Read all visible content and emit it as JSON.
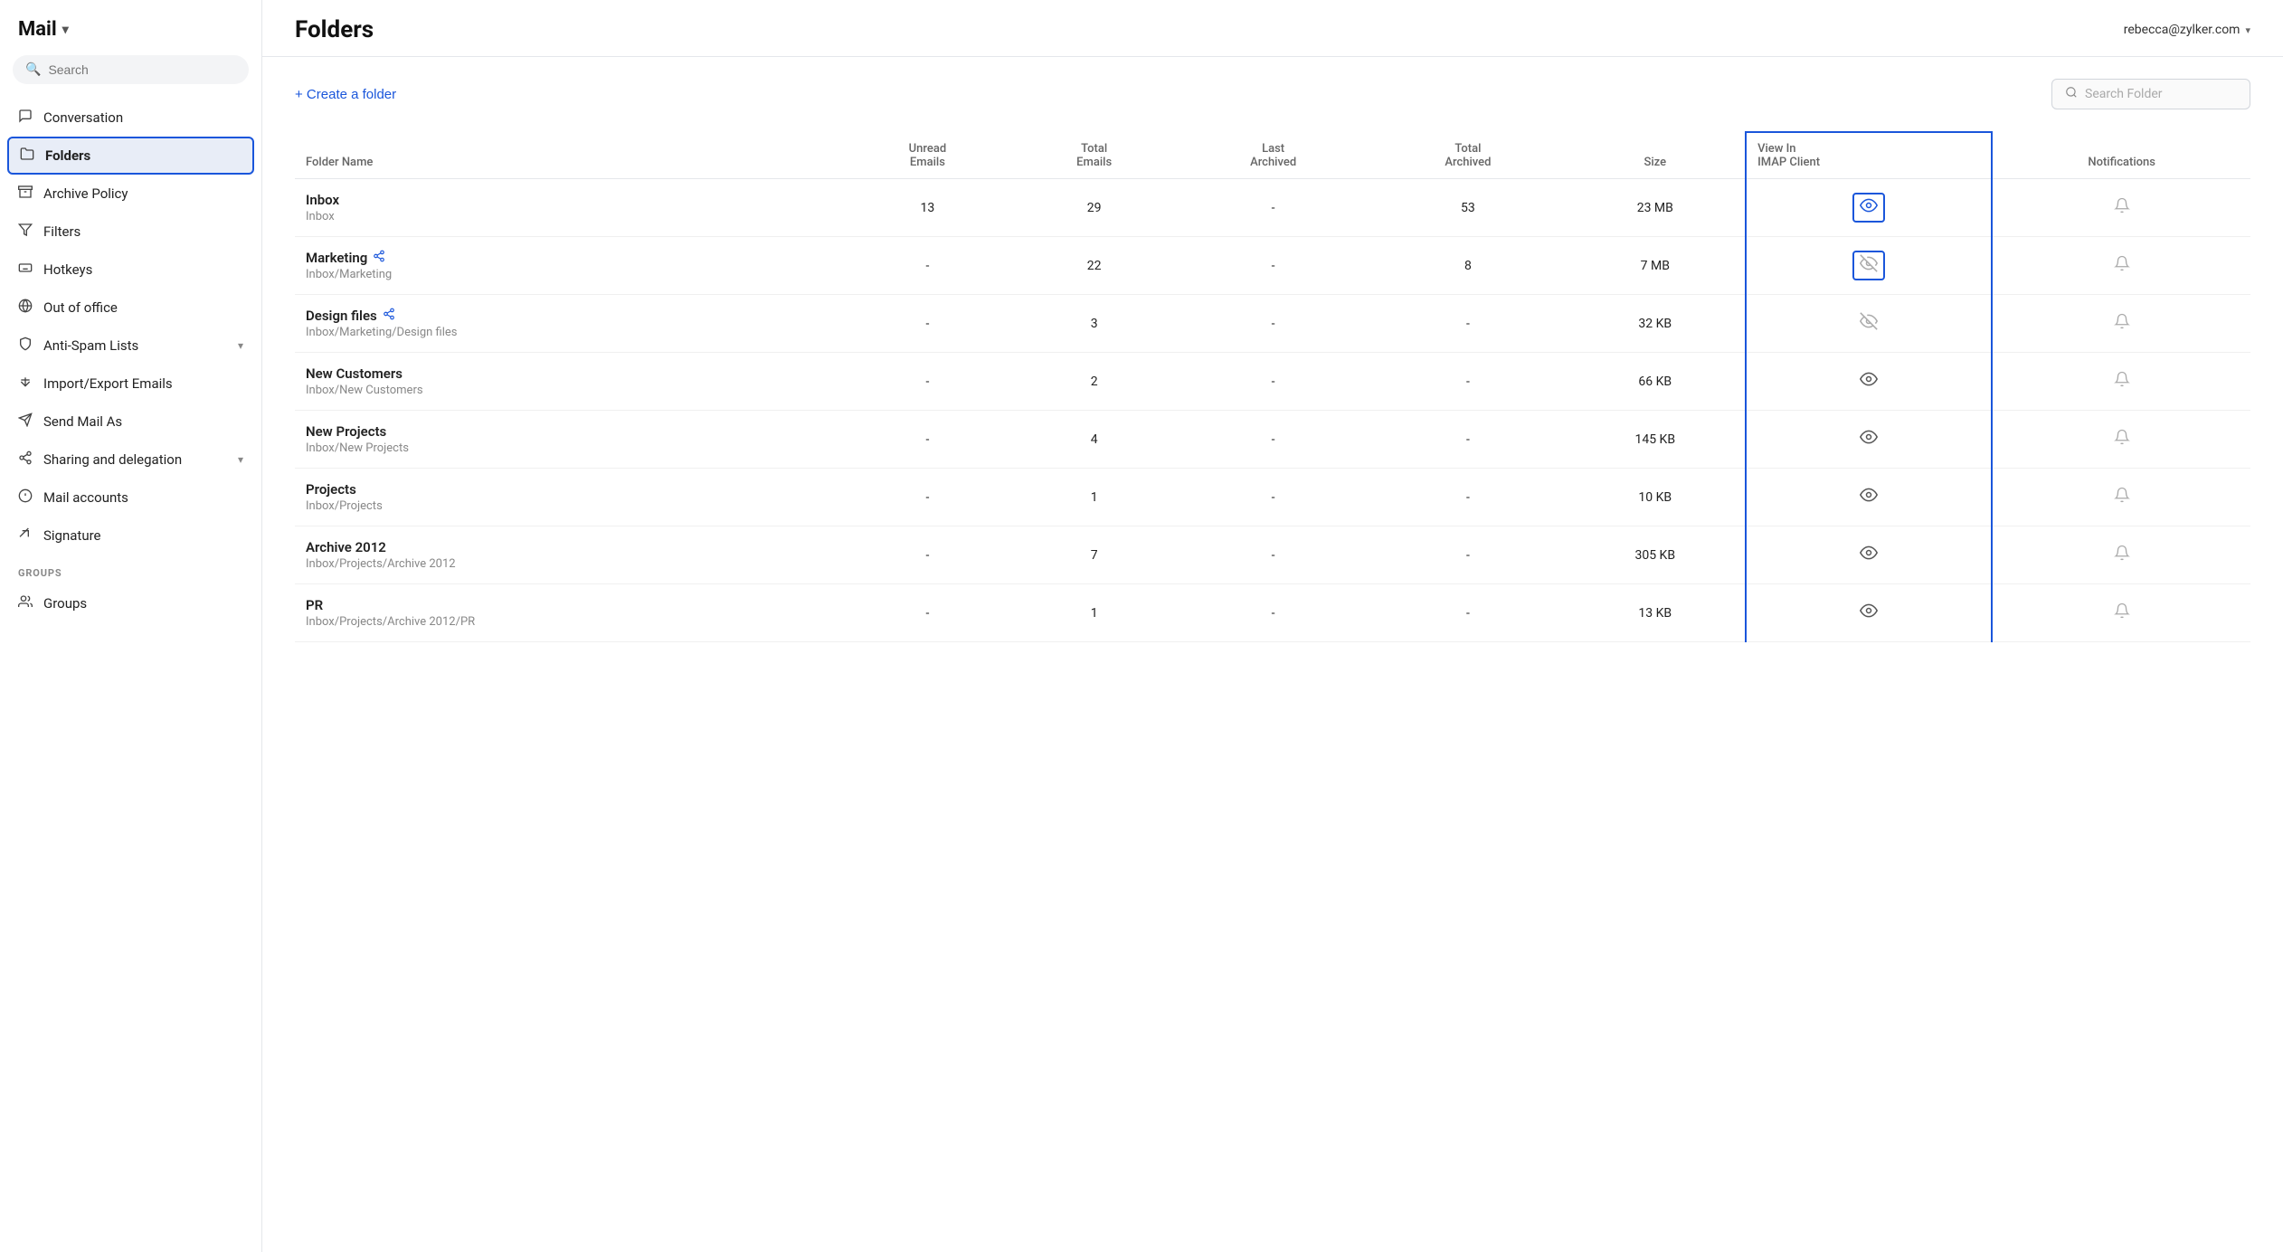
{
  "app": {
    "title": "Mail",
    "title_chevron": "▾",
    "user_email": "rebecca@zylker.com",
    "user_chevron": "▾"
  },
  "sidebar": {
    "search_placeholder": "Search",
    "items": [
      {
        "id": "conversation",
        "label": "Conversation",
        "icon": "💬"
      },
      {
        "id": "folders",
        "label": "Folders",
        "icon": "📁",
        "active": true
      },
      {
        "id": "archive-policy",
        "label": "Archive Policy",
        "icon": "🗂"
      },
      {
        "id": "filters",
        "label": "Filters",
        "icon": "⚡"
      },
      {
        "id": "hotkeys",
        "label": "Hotkeys",
        "icon": "⌨"
      },
      {
        "id": "out-of-office",
        "label": "Out of office",
        "icon": "✈"
      },
      {
        "id": "anti-spam",
        "label": "Anti-Spam Lists",
        "icon": "🛡",
        "has_chevron": true
      },
      {
        "id": "import-export",
        "label": "Import/Export Emails",
        "icon": "↕"
      },
      {
        "id": "send-mail-as",
        "label": "Send Mail As",
        "icon": "↗"
      },
      {
        "id": "sharing",
        "label": "Sharing and delegation",
        "icon": "🔗",
        "has_chevron": true
      },
      {
        "id": "mail-accounts",
        "label": "Mail accounts",
        "icon": "📧"
      },
      {
        "id": "signature",
        "label": "Signature",
        "icon": "✏"
      }
    ],
    "groups": [
      {
        "id": "groups-label",
        "label": "GROUPS"
      },
      {
        "id": "groups",
        "label": "Groups",
        "icon": "👤"
      }
    ]
  },
  "main": {
    "page_title": "Folders",
    "create_folder_label": "+ Create a folder",
    "search_folder_placeholder": "Search Folder",
    "table": {
      "headers": {
        "folder_name": "Folder Name",
        "unread_emails": "Unread\nEmails",
        "total_emails": "Total\nEmails",
        "last_archived": "Last\nArchived",
        "total_archived": "Total\nArchived",
        "size": "Size",
        "view_in_imap": "View In\nIMAP Client",
        "notifications": "Notifications"
      },
      "rows": [
        {
          "name": "Inbox",
          "path": "Inbox",
          "shared": false,
          "unread": "13",
          "total": "29",
          "last_archived": "-",
          "total_archived": "53",
          "size": "23 MB",
          "imap_state": "visible",
          "imap_border": "top"
        },
        {
          "name": "Marketing",
          "path": "Inbox/Marketing",
          "shared": true,
          "unread": "-",
          "total": "22",
          "last_archived": "-",
          "total_archived": "8",
          "size": "7 MB",
          "imap_state": "hidden",
          "imap_border": "middle"
        },
        {
          "name": "Design files",
          "path": "Inbox/Marketing/Design files",
          "shared": true,
          "unread": "-",
          "total": "3",
          "last_archived": "-",
          "total_archived": "-",
          "size": "32 KB",
          "imap_state": "inactive-hidden",
          "imap_border": "middle"
        },
        {
          "name": "New Customers",
          "path": "Inbox/New Customers",
          "shared": false,
          "unread": "-",
          "total": "2",
          "last_archived": "-",
          "total_archived": "-",
          "size": "66 KB",
          "imap_state": "eye-visible",
          "imap_border": "middle"
        },
        {
          "name": "New Projects",
          "path": "Inbox/New Projects",
          "shared": false,
          "unread": "-",
          "total": "4",
          "last_archived": "-",
          "total_archived": "-",
          "size": "145 KB",
          "imap_state": "eye-visible",
          "imap_border": "middle"
        },
        {
          "name": "Projects",
          "path": "Inbox/Projects",
          "shared": false,
          "unread": "-",
          "total": "1",
          "last_archived": "-",
          "total_archived": "-",
          "size": "10 KB",
          "imap_state": "eye-visible",
          "imap_border": "middle"
        },
        {
          "name": "Archive 2012",
          "path": "Inbox/Projects/Archive 2012",
          "shared": false,
          "unread": "-",
          "total": "7",
          "last_archived": "-",
          "total_archived": "-",
          "size": "305 KB",
          "imap_state": "eye-visible",
          "imap_border": "middle"
        },
        {
          "name": "PR",
          "path": "Inbox/Projects/Archive 2012/PR",
          "shared": false,
          "unread": "-",
          "total": "1",
          "last_archived": "-",
          "total_archived": "-",
          "size": "13 KB",
          "imap_state": "eye-visible",
          "imap_border": "bottom"
        }
      ]
    }
  }
}
